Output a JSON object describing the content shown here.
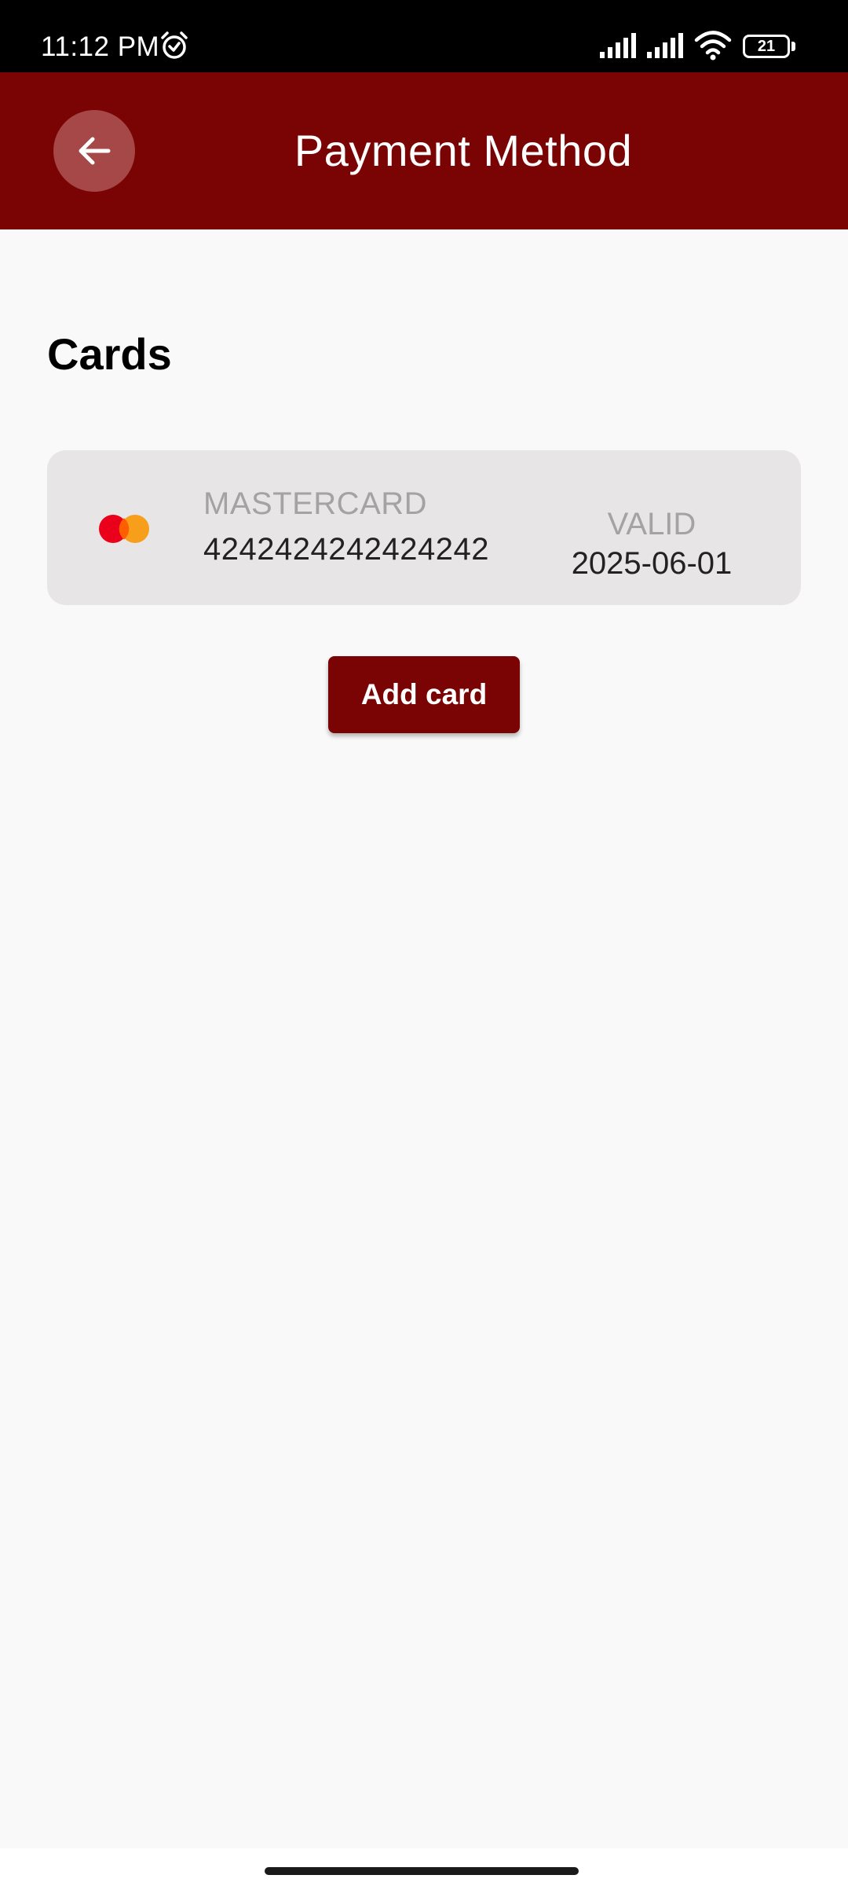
{
  "status_bar": {
    "time": "11:12 PM",
    "battery_level": "21",
    "icons": [
      "alarm-icon",
      "signal-icon",
      "signal-icon",
      "wifi-icon",
      "battery-icon"
    ]
  },
  "header": {
    "title": "Payment Method",
    "back_icon": "arrow-left-icon"
  },
  "cards_section": {
    "title": "Cards",
    "cards": [
      {
        "brand": "MASTERCARD",
        "number": "4242424242424242",
        "valid_label": "VALID",
        "valid_date": "2025-06-01",
        "logo_icon": "mastercard-logo-icon"
      }
    ],
    "add_button_label": "Add card"
  },
  "colors": {
    "primary": "#7a0404",
    "back_button_bg": "#a64848",
    "card_bg": "#e7e5e5",
    "page_bg": "#f9f9f9",
    "muted_text": "#a3a3a3",
    "mastercard_red": "#eb001b",
    "mastercard_orange": "#f79e1b"
  }
}
